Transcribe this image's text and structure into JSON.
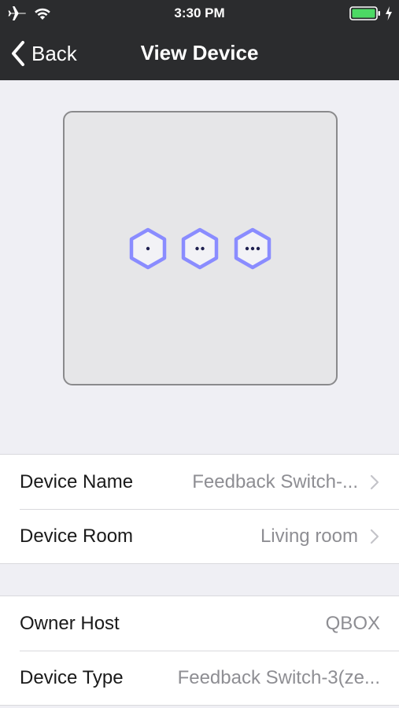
{
  "status_bar": {
    "time": "3:30 PM",
    "icons": [
      "airplane-icon",
      "wifi-icon",
      "battery-icon",
      "charging-bolt-icon"
    ],
    "battery_color": "#4cd964"
  },
  "nav": {
    "back_label": "Back",
    "title": "View Device"
  },
  "preview": {
    "switch_buttons": [
      {
        "dots": 1,
        "color": "#8a8cff"
      },
      {
        "dots": 2,
        "color": "#8a8cff"
      },
      {
        "dots": 3,
        "color": "#8a8cff"
      }
    ]
  },
  "device_info": [
    {
      "label": "Device Name",
      "value": "Feedback Switch-...",
      "chevron": true
    },
    {
      "label": "Device Room",
      "value": "Living room",
      "chevron": true
    }
  ],
  "host_info": [
    {
      "label": "Owner Host",
      "value": "QBOX",
      "chevron": false
    },
    {
      "label": "Device Type",
      "value": "Feedback Switch-3(ze...",
      "chevron": false
    }
  ],
  "colors": {
    "nav_background": "#2b2c2e",
    "page_background": "#efeff4",
    "secondary_text": "#8e8e93"
  }
}
